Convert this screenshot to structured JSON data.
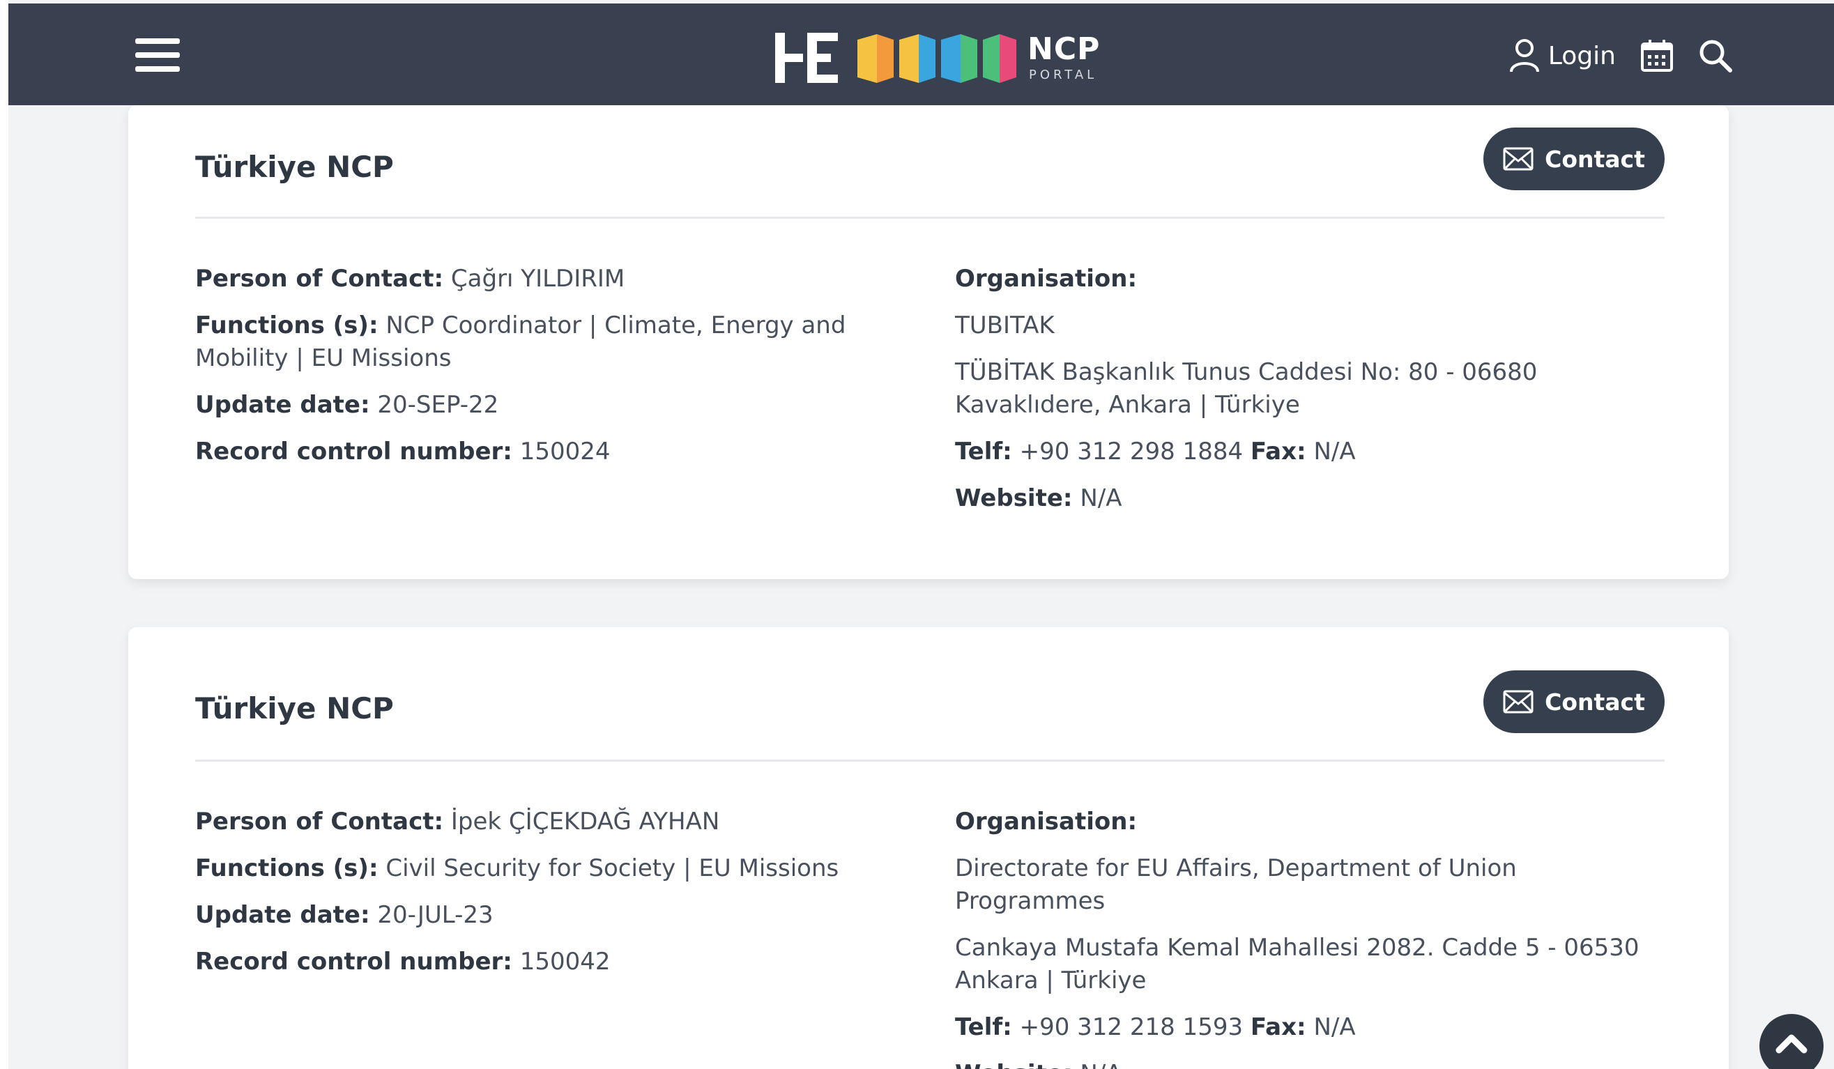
{
  "header": {
    "logo_text": "NCP",
    "logo_sub": "PORTAL",
    "logo_mark": "HE",
    "login_label": "Login",
    "icons": [
      "menu-icon",
      "user-icon",
      "calendar-icon",
      "search-icon"
    ]
  },
  "cards": [
    {
      "title": "Türkiye NCP",
      "contact_label": "Contact",
      "person_label": "Person of Contact:",
      "person": "Çağrı YILDIRIM",
      "functions_label": "Functions (s):",
      "functions": "NCP Coordinator | Climate, Energy and Mobility | EU Missions",
      "update_label": "Update date:",
      "update": "20-SEP-22",
      "record_label": "Record control number:",
      "record": "150024",
      "org_label": "Organisation:",
      "org": "TUBITAK",
      "address": "TÜBİTAK Başkanlık Tunus Caddesi No: 80 - 06680 Kavaklıdere, Ankara | Türkiye",
      "tel_label": "Telf:",
      "tel": "+90 312 298 1884",
      "fax_label": "Fax:",
      "fax": "N/A",
      "website_label": "Website:",
      "website": "N/A"
    },
    {
      "title": "Türkiye NCP",
      "contact_label": "Contact",
      "person_label": "Person of Contact:",
      "person": "İpek ÇİÇEKDAĞ AYHAN",
      "functions_label": "Functions (s):",
      "functions": "Civil Security for Society | EU Missions",
      "update_label": "Update date:",
      "update": "20-JUL-23",
      "record_label": "Record control number:",
      "record": "150042",
      "org_label": "Organisation:",
      "org": "Directorate for EU Affairs, Department of Union Programmes",
      "address": "Cankaya Mustafa Kemal Mahallesi 2082. Cadde 5 - 06530 Ankara | Türkiye",
      "tel_label": "Telf:",
      "tel": "+90 312 218 1593",
      "fax_label": "Fax:",
      "fax": "N/A",
      "website_label": "Website:",
      "website": "N/A"
    }
  ],
  "colors": {
    "header_bg": "#394150",
    "button_bg": "#363f4d",
    "logo_orange": "#f29a3c",
    "logo_yellow": "#f5c341",
    "logo_blue": "#3aa6e0",
    "logo_green": "#4cbf7a",
    "logo_pink": "#e84a7a"
  }
}
